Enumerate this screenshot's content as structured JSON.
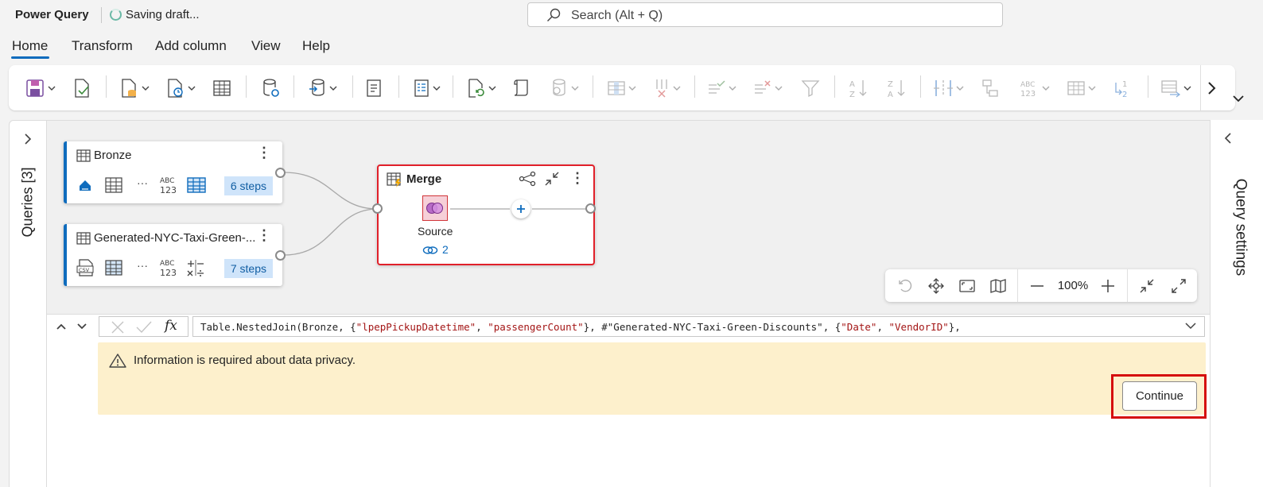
{
  "app": {
    "title": "Power Query",
    "status": "Saving draft..."
  },
  "search": {
    "placeholder": "Search (Alt + Q)"
  },
  "tabs": [
    {
      "label": "Home",
      "active": true
    },
    {
      "label": "Transform"
    },
    {
      "label": "Add column"
    },
    {
      "label": "View"
    },
    {
      "label": "Help"
    }
  ],
  "ribbon": {
    "icons": [
      "save-icon",
      "validate-icon",
      "get-data-icon",
      "recent-sources-icon",
      "enter-data-icon",
      "data-source-settings-icon",
      "manage-connections-icon",
      "query-properties-icon",
      "advanced-editor-icon",
      "refresh-icon",
      "options-icon",
      "manage-parameters-icon",
      "choose-columns-icon",
      "remove-columns-icon",
      "keep-rows-icon",
      "remove-rows-icon",
      "filter-icon",
      "sort-ascending-icon",
      "sort-descending-icon",
      "split-column-icon",
      "group-by-icon",
      "data-type-icon",
      "use-first-row-headers-icon",
      "replace-values-icon",
      "combine-icon"
    ]
  },
  "queries_pane": {
    "label": "Queries [3]"
  },
  "settings_pane": {
    "label": "Query settings"
  },
  "diagram": {
    "queries": [
      {
        "name": "Bronze",
        "steps": "6 steps"
      },
      {
        "name": "Generated-NYC-Taxi-Green-...",
        "steps": "7 steps"
      }
    ],
    "merge": {
      "name": "Merge",
      "step_label": "Source",
      "link_count": "2"
    }
  },
  "view_controls": {
    "zoom": "100%"
  },
  "formula": {
    "parts": [
      {
        "t": "Table.NestedJoin(Bronze, {",
        "s": false
      },
      {
        "t": "\"lpepPickupDatetime\"",
        "s": true
      },
      {
        "t": ", ",
        "s": false
      },
      {
        "t": "\"passengerCount\"",
        "s": true
      },
      {
        "t": "}, #\"Generated-NYC-Taxi-Green-Discounts\", {",
        "s": false
      },
      {
        "t": "\"Date\"",
        "s": true
      },
      {
        "t": ", ",
        "s": false
      },
      {
        "t": "\"VendorID\"",
        "s": true
      },
      {
        "t": "},",
        "s": false
      }
    ]
  },
  "privacy": {
    "message": "Information is required about data privacy.",
    "continue_label": "Continue"
  },
  "colors": {
    "accent": "#0f6cbd",
    "highlight": "#d50d0d",
    "banner": "#fdf0cc"
  }
}
